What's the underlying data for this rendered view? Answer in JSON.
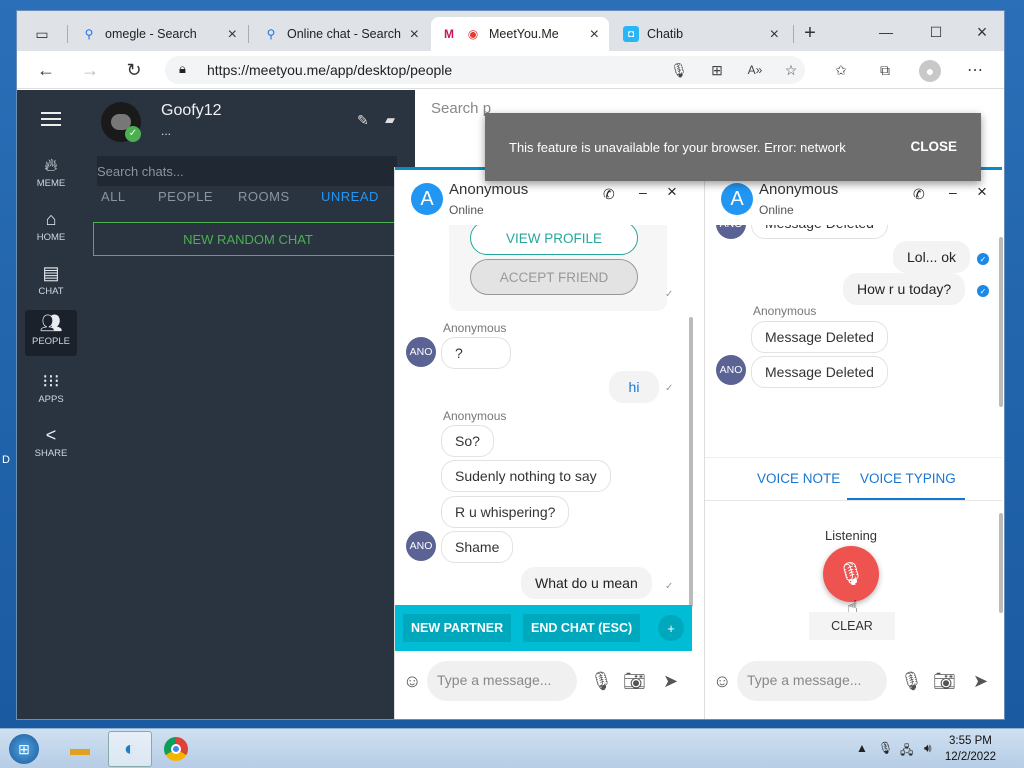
{
  "browser": {
    "tabs": [
      {
        "label": "omegle - Search",
        "icon": "search-icon"
      },
      {
        "label": "Online chat - Search",
        "icon": "search-icon"
      },
      {
        "label": "MeetYou.Me",
        "icon": "meetyou-icon"
      },
      {
        "label": "Chatib",
        "icon": "chatib-icon"
      }
    ],
    "url": "https://meetyou.me/app/desktop/people"
  },
  "rail": [
    {
      "label": "MEME",
      "icon": "flame-icon"
    },
    {
      "label": "HOME",
      "icon": "home-icon"
    },
    {
      "label": "CHAT",
      "icon": "chat-icon"
    },
    {
      "label": "PEOPLE",
      "icon": "people-icon"
    },
    {
      "label": "APPS",
      "icon": "apps-icon"
    },
    {
      "label": "SHARE",
      "icon": "share-icon"
    }
  ],
  "sidebar": {
    "username": "Goofy12",
    "status": "...",
    "search_placeholder": "Search chats...",
    "filters": [
      "ALL",
      "PEOPLE",
      "ROOMS",
      "UNREAD"
    ],
    "new_random": "NEW RANDOM CHAT"
  },
  "people_search": "Search p",
  "toast": {
    "message": "This feature is unavailable for your browser. Error: network",
    "close": "CLOSE"
  },
  "chat1": {
    "name": "Anonymous",
    "status": "Online",
    "view_profile": "VIEW PROFILE",
    "accept_friend": "ACCEPT FRIEND",
    "sender": "Anonymous",
    "ano": "ANO",
    "m1": "?",
    "m2": "hi",
    "m3": "So?",
    "m4": "Sudenly nothing to say",
    "m5": "R u whispering?",
    "m6": "Shame",
    "m7": "What do u mean",
    "new_partner": "NEW PARTNER",
    "end_chat": "END CHAT (ESC)",
    "input_placeholder": "Type a message..."
  },
  "chat2": {
    "name": "Anonymous",
    "status": "Online",
    "sender": "Anonymous",
    "ano": "ANO",
    "m0": "Message Deleted",
    "m1": "Lol... ok",
    "m2": "How r u today?",
    "m3": "Message Deleted",
    "m4": "Message Deleted",
    "voice_note": "VOICE NOTE",
    "voice_typing": "VOICE TYPING",
    "listening": "Listening",
    "clear": "CLEAR",
    "input_placeholder": "Type a message..."
  },
  "taskbar": {
    "time": "3:55 PM",
    "date": "12/2/2022"
  },
  "desktop_fragment": "D"
}
